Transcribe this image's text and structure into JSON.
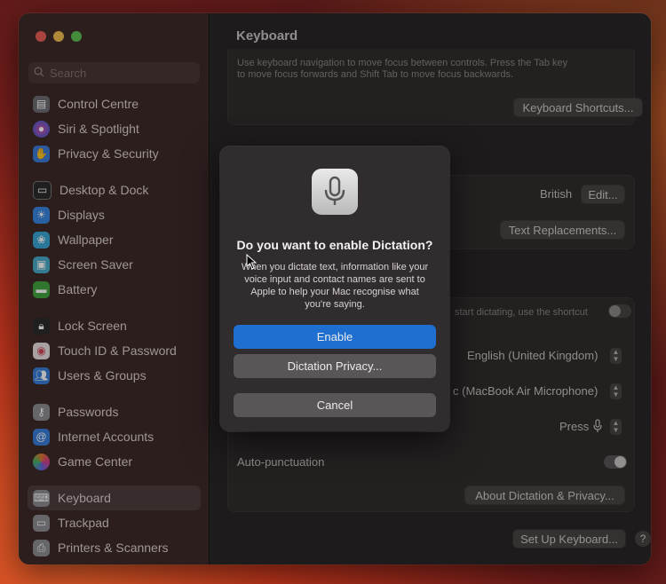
{
  "sidebar": {
    "search_placeholder": "Search",
    "items": [
      {
        "label": "Control Centre",
        "icon": "control-centre-icon",
        "color": "#6e6e73"
      },
      {
        "label": "Siri & Spotlight",
        "icon": "siri-icon",
        "color": "#b0306d"
      },
      {
        "label": "Privacy & Security",
        "icon": "hand-icon",
        "color": "#3d7bd9"
      },
      {
        "label": "Desktop & Dock",
        "icon": "desktop-dock-icon",
        "color": "#2b2b2b"
      },
      {
        "label": "Displays",
        "icon": "displays-icon",
        "color": "#3a86e0"
      },
      {
        "label": "Wallpaper",
        "icon": "wallpaper-icon",
        "color": "#3aa7d6"
      },
      {
        "label": "Screen Saver",
        "icon": "screen-saver-icon",
        "color": "#48a9c8"
      },
      {
        "label": "Battery",
        "icon": "battery-icon",
        "color": "#44a441"
      },
      {
        "label": "Lock Screen",
        "icon": "lock-icon",
        "color": "#2b2b2b"
      },
      {
        "label": "Touch ID & Password",
        "icon": "fingerprint-icon",
        "color": "#e8e0df"
      },
      {
        "label": "Users & Groups",
        "icon": "users-icon",
        "color": "#3a7fd9"
      },
      {
        "label": "Passwords",
        "icon": "key-icon",
        "color": "#8e8e93"
      },
      {
        "label": "Internet Accounts",
        "icon": "at-icon",
        "color": "#3a7fd9"
      },
      {
        "label": "Game Center",
        "icon": "game-center-icon",
        "color": "#e07a2f"
      },
      {
        "label": "Keyboard",
        "icon": "keyboard-icon",
        "color": "#8e8e93"
      },
      {
        "label": "Trackpad",
        "icon": "trackpad-icon",
        "color": "#8e8e93"
      },
      {
        "label": "Printers & Scanners",
        "icon": "printer-icon",
        "color": "#8e8e93"
      }
    ]
  },
  "content": {
    "title": "Keyboard",
    "nav_text": "Use keyboard navigation to move focus between controls. Press the Tab key to move focus forwards and Shift Tab to move focus backwards.",
    "keyboard_shortcuts_label": "Keyboard Shortcuts...",
    "input_source_value": "British",
    "edit_label": "Edit...",
    "text_replacements_label": "Text Replacements...",
    "dictation_hint": "start dictating, use the shortcut",
    "language_value": "English (United Kingdom)",
    "mic_value": "c (MacBook Air Microphone)",
    "shortcut_value": "Press",
    "auto_punctuation_label": "Auto-punctuation",
    "about_dictation_label": "About Dictation & Privacy...",
    "setup_keyboard_label": "Set Up Keyboard...",
    "help_label": "?"
  },
  "dialog": {
    "icon": "microphone-icon",
    "title": "Do you want to enable Dictation?",
    "body": "When you dictate text, information like your voice input and contact names are sent to Apple to help your Mac recognise what you're saying.",
    "enable_label": "Enable",
    "privacy_label": "Dictation Privacy...",
    "cancel_label": "Cancel"
  },
  "colors": {
    "accent": "#1f6fd1"
  }
}
